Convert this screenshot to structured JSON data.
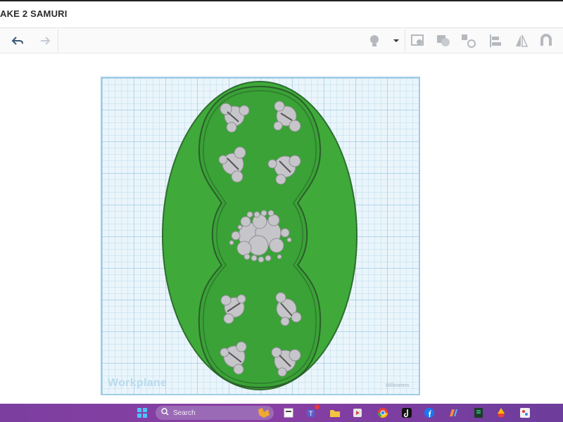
{
  "app": {
    "project_title": "AKE 2 SAMURI"
  },
  "toolbar": {
    "left_icons": [
      "undo-icon",
      "redo-icon"
    ],
    "right_icons": [
      "lightbulb-icon",
      "dropdown-caret-icon",
      "note-icon",
      "shape-group-icon",
      "mirror-pattern-icon",
      "align-icon",
      "mirror-icon",
      "magnet-icon"
    ]
  },
  "workplane": {
    "label": "Workplane",
    "units_label": "Millimeters"
  },
  "colors": {
    "base_green": "#3faa3a",
    "base_edge": "#2e7d32",
    "figure_grey": "#c9c9cc",
    "workplane_bg": "#eaf5fb"
  },
  "taskbar": {
    "search_placeholder": "Search",
    "icons": [
      "windows-start-icon",
      "search-icon",
      "widget-icon",
      "file-explorer-icon",
      "teams-icon",
      "folder-icon",
      "media-icon",
      "chrome-icon",
      "tiktok-icon",
      "facebook-icon",
      "copilot-icon",
      "app-icon",
      "drive-icon",
      "paint-icon"
    ]
  }
}
